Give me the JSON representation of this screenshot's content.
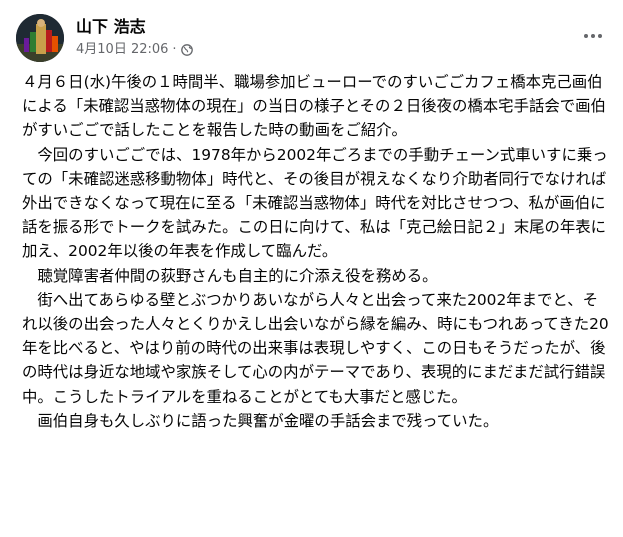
{
  "post": {
    "author": "山下 浩志",
    "date": "4月10日 22:06",
    "separator": "·",
    "privacy_icon": "globe-icon",
    "more_icon": "more-horizontal-icon",
    "paragraphs": [
      "４月６日(水)午後の１時間半、職場参加ビューローでのすいごごカフェ橋本克己画伯による「未確認当惑物体の現在」の当日の様子とその２日後夜の橋本宅手話会で画伯がすいごごで話したことを報告した時の動画をご紹介。",
      "　今回のすいごごでは、1978年から2002年ごろまでの手動チェーン式車いすに乗っての「未確認迷惑移動物体」時代と、その後目が視えなくなり介助者同行でなければ外出できなくなって現在に至る「未確認当惑物体」時代を対比させつつ、私が画伯に話を振る形でトークを試みた。この日に向けて、私は「克己絵日記２」末尾の年表に加え、2002年以後の年表を作成して臨んだ。",
      "　聴覚障害者仲間の荻野さんも自主的に介添え役を務める。",
      "　街へ出てあらゆる壁とぶつかりあいながら人々と出会って来た2002年までと、それ以後の出会った人々とくりかえし出会いながら縁を編み、時にもつれあってきた20年を比べると、やはり前の時代の出来事は表現しやすく、この日もそうだったが、後の時代は身近な地域や家族そして心の内がテーマであり、表現的にまだまだ試行錯誤中。こうしたトライアルを重ねることがとても大事だと感じた。",
      "　画伯自身も久しぶりに語った興奮が金曜の手話会まで残っていた。"
    ]
  }
}
